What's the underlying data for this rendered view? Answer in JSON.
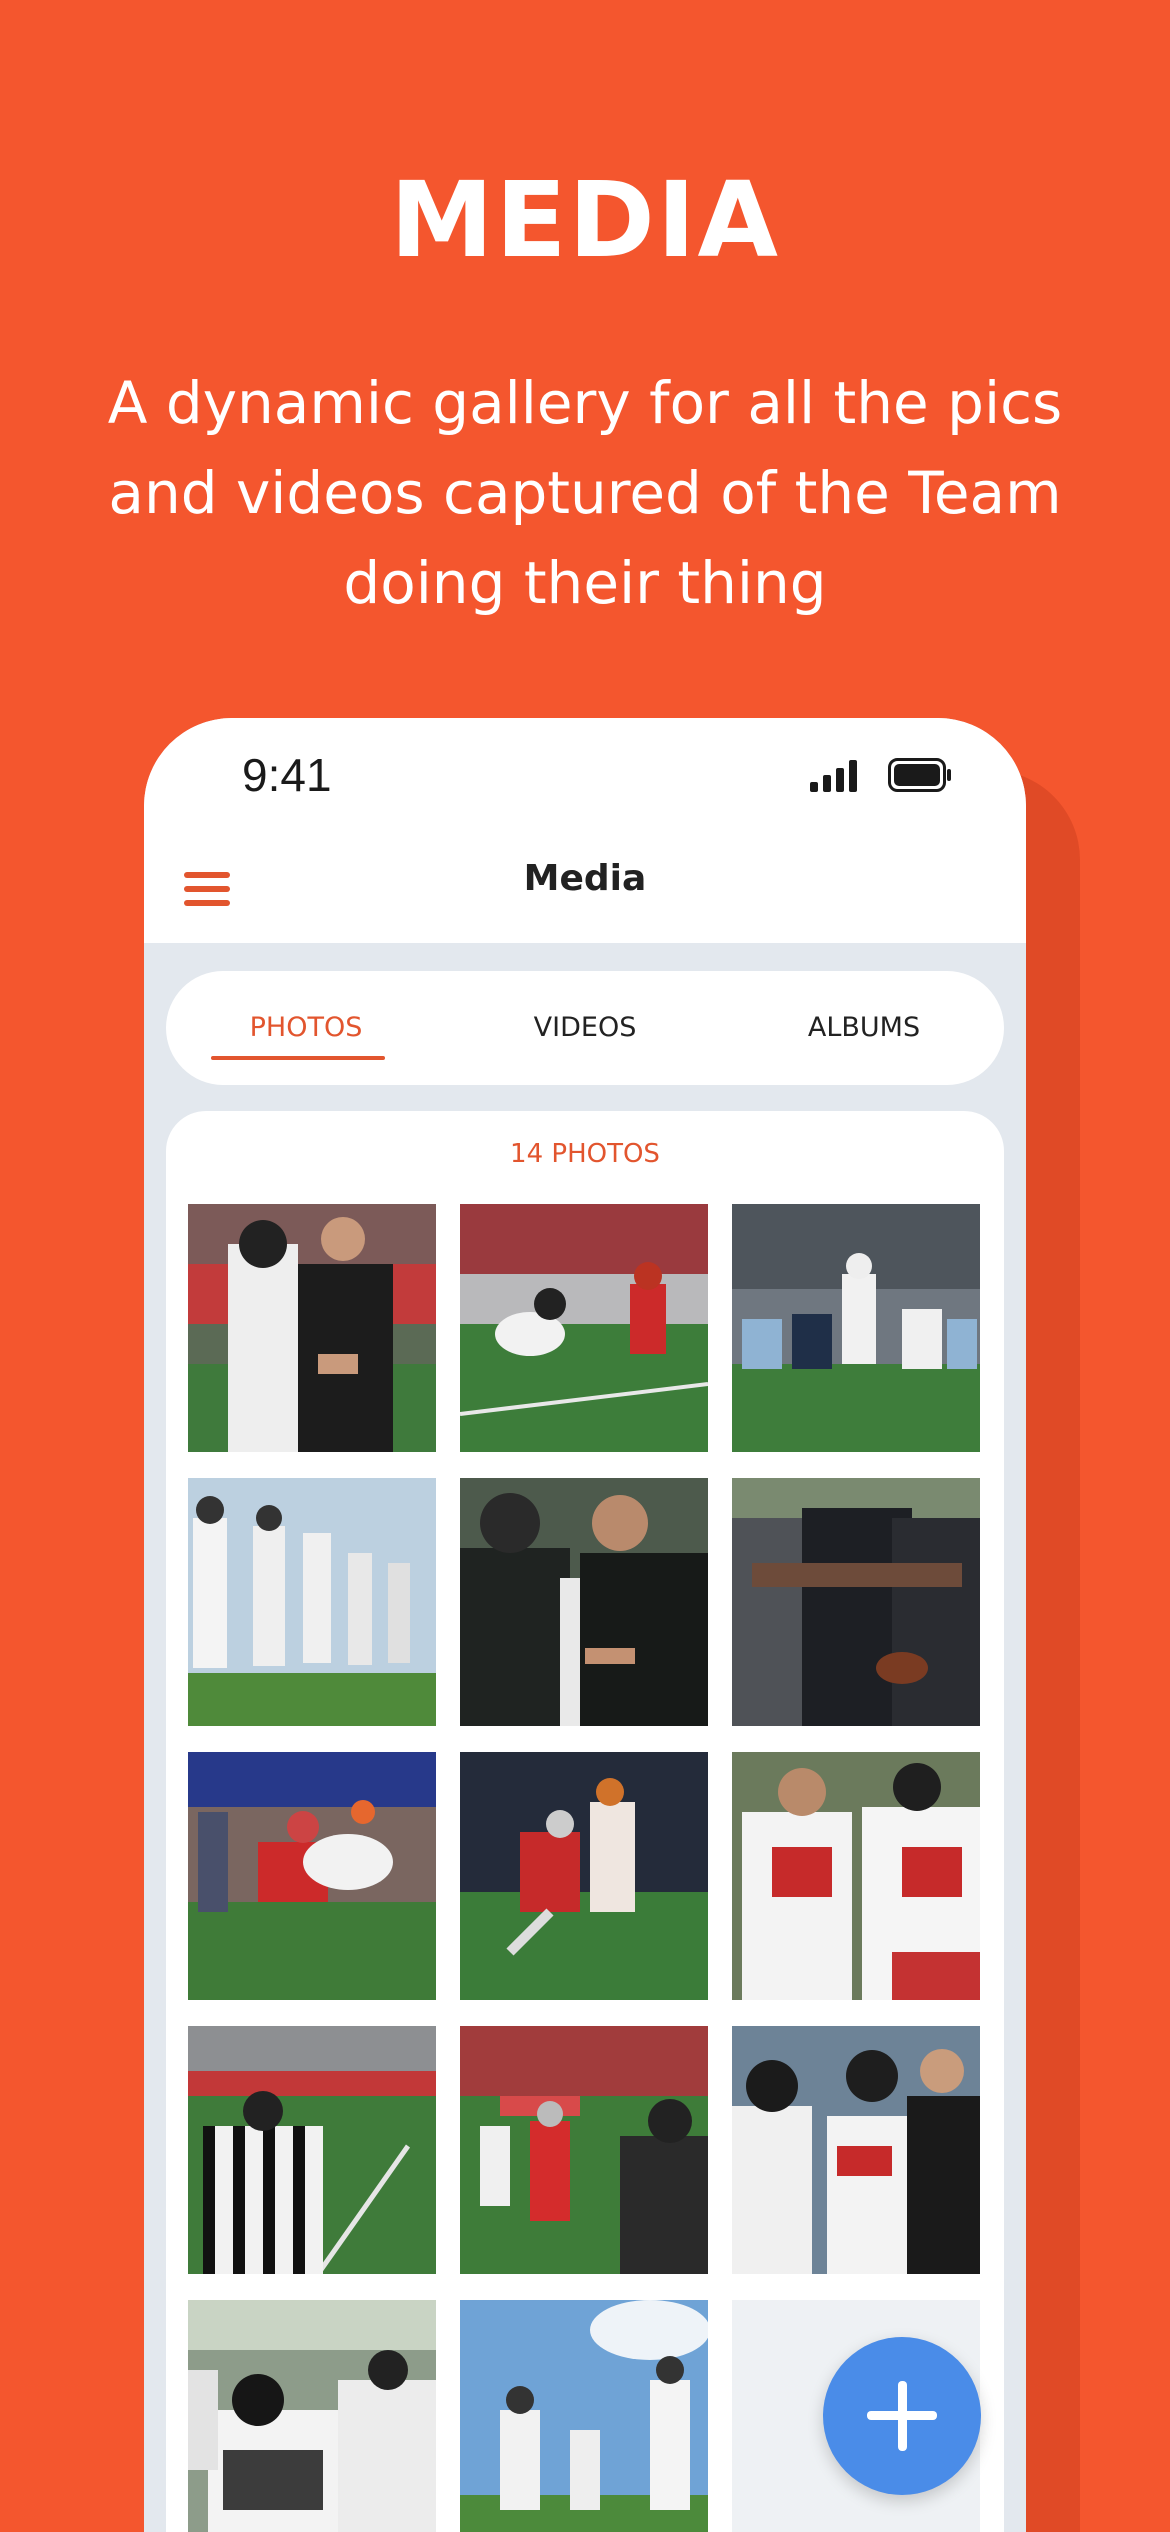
{
  "promo": {
    "title": "MEDIA",
    "subtitle": "A dynamic gallery for all the pics and videos captured of the Team doing their thing",
    "background_color": "#F4562E"
  },
  "status_bar": {
    "time": "9:41",
    "signal_icon": "cellular-signal-icon",
    "battery_icon": "battery-icon"
  },
  "nav": {
    "title": "Media",
    "menu_icon": "hamburger-menu-icon"
  },
  "tabs": [
    {
      "label": "PHOTOS",
      "active": true
    },
    {
      "label": "VIDEOS",
      "active": false
    },
    {
      "label": "ALBUMS",
      "active": false
    }
  ],
  "gallery": {
    "count_label": "14 PHOTOS",
    "photos": [
      {
        "subject": "coaches-on-sideline-headsets"
      },
      {
        "subject": "players-at-line-of-scrimmage-stadium"
      },
      {
        "subject": "lineup-snap-crowd-background"
      },
      {
        "subject": "players-standing-on-sideline"
      },
      {
        "subject": "coaches-checking-phone-headsets"
      },
      {
        "subject": "team-huddle-prayer"
      },
      {
        "subject": "tackle-in-action"
      },
      {
        "subject": "player-leaping-catch"
      },
      {
        "subject": "players-numbers-75-60-huddle"
      },
      {
        "subject": "referee-on-field"
      },
      {
        "subject": "game-play-sideline-view"
      },
      {
        "subject": "players-on-bench-sideline"
      },
      {
        "subject": "player-85-group"
      },
      {
        "subject": "players-running-onto-field"
      }
    ]
  },
  "fab": {
    "icon": "plus-icon",
    "color": "#4A8CE8"
  },
  "colors": {
    "accent": "#E2552E",
    "panel_bg": "#E3E8EE"
  }
}
